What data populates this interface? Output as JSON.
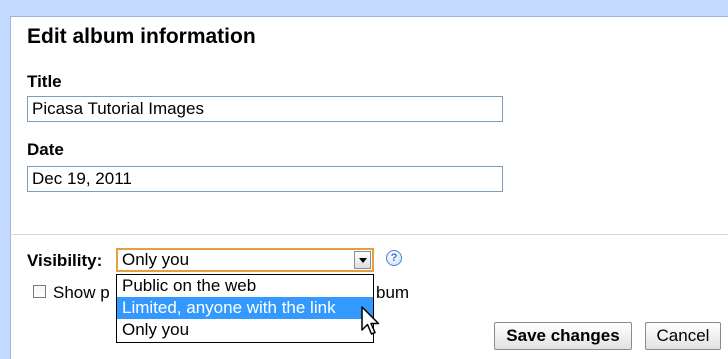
{
  "dialog": {
    "title": "Edit album information",
    "title_field": {
      "label": "Title",
      "value": "Picasa Tutorial Images"
    },
    "date_field": {
      "label": "Date",
      "value": "Dec 19, 2011"
    },
    "visibility": {
      "label": "Visibility:",
      "selected": "Only you",
      "options": [
        "Public on the web",
        "Limited, anyone with the link",
        "Only you"
      ],
      "highlighted_option": "Limited, anyone with the link",
      "help_icon": "question-icon"
    },
    "show_checkbox": {
      "label_visible_start": "Show p",
      "label_visible_end": "bum",
      "checked": false
    },
    "buttons": {
      "save": "Save changes",
      "cancel": "Cancel"
    }
  },
  "colors": {
    "background": "#c3d9ff",
    "dropdown_highlight": "#3399ff",
    "select_focus_border": "#e3a040"
  }
}
